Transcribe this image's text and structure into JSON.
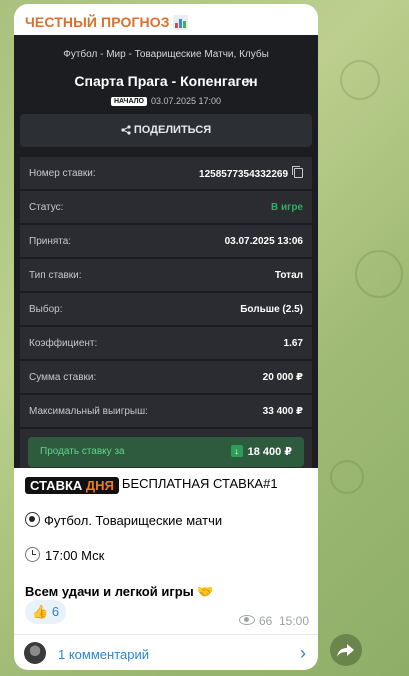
{
  "channel": {
    "name": "ЧЕСТНЫЙ ПРОГНОЗ"
  },
  "bet_screenshot": {
    "breadcrumb": "Футбол - Мир - Товарищеские Матчи, Клубы",
    "match_title": "Спарта Прага - Копенгаген",
    "start_badge": "НАЧАЛО",
    "start_datetime": "03.07.2025 17:00",
    "share_label": "ПОДЕЛИТЬСЯ",
    "rows": [
      {
        "label": "Номер ставки:",
        "value": "1258577354332269"
      },
      {
        "label": "Статус:",
        "value": "В игре"
      },
      {
        "label": "Принята:",
        "value": "03.07.2025 13:06"
      },
      {
        "label": "Тип ставки:",
        "value": "Тотал"
      },
      {
        "label": "Выбор:",
        "value": "Больше (2.5)"
      },
      {
        "label": "Коэффициент:",
        "value": "1.67"
      },
      {
        "label": "Сумма ставки:",
        "value": "20 000 ₽"
      },
      {
        "label": "Максимальный выигрыш:",
        "value": "33 400 ₽"
      }
    ],
    "sell_label": "Продать ставку за",
    "sell_amount": "18 400 ₽",
    "status_color": "#2fae62"
  },
  "post": {
    "badge_word1": "СТАВКА",
    "badge_word2": "ДНЯ",
    "headline": "БЕСПЛАТНАЯ СТАВКА#1",
    "line_sport": "Футбол. Товарищеские матчи",
    "line_time": "17:00 Мск",
    "line_wish": "Всем удачи и легкой игры",
    "reaction_count": "6",
    "views": "66",
    "time": "15:00",
    "comments_label": "1 комментарий"
  },
  "icons": [
    "chart-emoji-icon",
    "chevron-right-icon",
    "share-icon",
    "copy-icon",
    "arrow-down-icon",
    "soccer-ball-icon",
    "clock-icon",
    "handshake-icon",
    "thumbs-up-icon",
    "eye-icon",
    "avatar",
    "forward-icon"
  ],
  "colors": {
    "channel_name": "#d8722e",
    "link_blue": "#2b86d1",
    "sell_bg": "#2e5a3e",
    "sell_text": "#5fd58a",
    "badge_accent": "#f07b1c"
  }
}
